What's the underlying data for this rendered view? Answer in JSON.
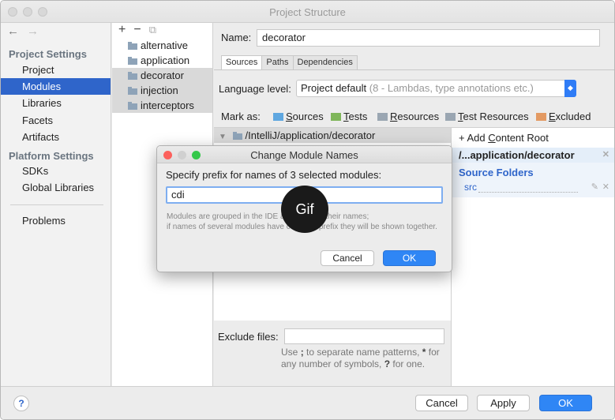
{
  "window": {
    "title": "Project Structure"
  },
  "sidebar": {
    "back": "←",
    "forward": "→",
    "project_settings_title": "Project Settings",
    "project_items": [
      "Project",
      "Modules",
      "Libraries",
      "Facets",
      "Artifacts"
    ],
    "platform_settings_title": "Platform Settings",
    "platform_items": [
      "SDKs",
      "Global Libraries"
    ],
    "problems": "Problems",
    "selected": "Modules"
  },
  "modules": {
    "add": "+",
    "remove": "−",
    "copy": "⧉",
    "items": [
      "alternative",
      "application",
      "decorator",
      "injection",
      "interceptors"
    ]
  },
  "main": {
    "name_label": "Name:",
    "name_value": "decorator",
    "tabs": [
      "Sources",
      "Paths",
      "Dependencies"
    ],
    "language_label": "Language level:",
    "language_value": "Project default",
    "language_hint": "(8 - Lambdas, type annotations etc.)",
    "mark_as_label": "Mark as:",
    "mark_items": [
      {
        "prefix": "",
        "u": "S",
        "rest": "ources",
        "color": "#5fa7e0"
      },
      {
        "prefix": "",
        "u": "T",
        "rest": "ests",
        "color": "#7fb65a"
      },
      {
        "prefix": "",
        "u": "R",
        "rest": "esources",
        "color": "#9aa6b2"
      },
      {
        "prefix": "",
        "u": "T",
        "rest": "est Resources",
        "color": "#9aa6b2"
      },
      {
        "prefix": "",
        "u": "E",
        "rest": "xcluded",
        "color": "#e39a63"
      }
    ],
    "tree_path": "/IntelliJ/application/decorator",
    "add_content_root_prefix": "+ Add ",
    "add_content_root_u": "C",
    "add_content_root_rest": "ontent Root",
    "content_root": "/...application/decorator",
    "source_folders_title": "Source Folders",
    "source_folder": "src",
    "exclude_label": "Exclude files:",
    "exclude_help_1": "Use ",
    "exclude_help_sep": ";",
    "exclude_help_2": " to separate name patterns, ",
    "exclude_help_star": "*",
    "exclude_help_3": " for any number of symbols, ",
    "exclude_help_q": "?",
    "exclude_help_4": " for one."
  },
  "footer": {
    "help": "?",
    "cancel": "Cancel",
    "apply": "Apply",
    "ok": "OK"
  },
  "dialog": {
    "title": "Change Module Names",
    "prompt": "Specify prefix for names of 3 selected modules:",
    "input_value": "cdi",
    "help_1": "Modules are grouped in the IDE according to their names;",
    "help_2": "if names of several modules have common prefix they will be shown together.",
    "help_3": "together.",
    "cancel": "Cancel",
    "ok": "OK"
  },
  "overlay": {
    "gif": "Gif"
  },
  "colors": {
    "accent": "#2f65ca",
    "primary_button": "#2f86f5",
    "close_dot": "#fc605c",
    "min_dot": "#fdbc40",
    "max_dot": "#34c84a"
  }
}
